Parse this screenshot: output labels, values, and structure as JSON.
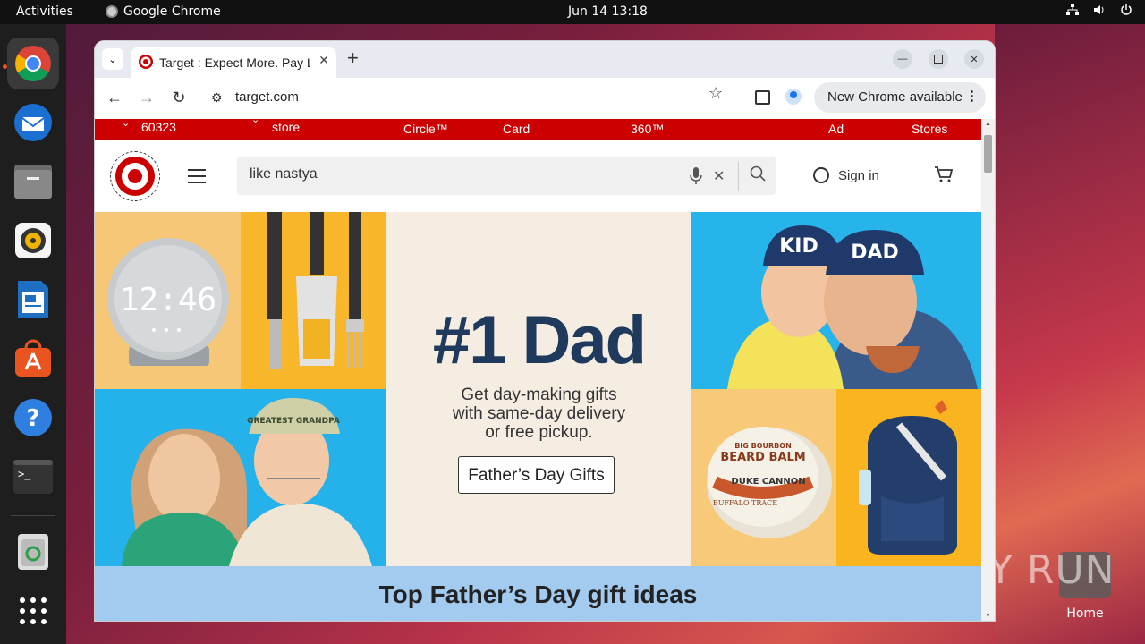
{
  "topbar": {
    "activities": "Activities",
    "app_name": "Google Chrome",
    "clock": "Jun 14  13:18"
  },
  "dock": {
    "items": [
      "chrome-icon",
      "thunderbird-icon",
      "files-icon",
      "rhythmbox-icon",
      "writer-icon",
      "software-icon",
      "help-icon",
      "terminal-icon",
      "trash-icon",
      "apps-grid-icon"
    ]
  },
  "desktop": {
    "home_label": "Home",
    "watermark": "ANY RUN"
  },
  "browser": {
    "tab_title": "Target : Expect More. Pay Less.",
    "new_tab": "+",
    "url": "target.com",
    "update_chip": "New Chrome available"
  },
  "page": {
    "redbar": {
      "zip": "60323",
      "store": "store",
      "circle": "Circle™",
      "card": "Card",
      "three60": "360™",
      "ad": "Ad",
      "stores": "Stores"
    },
    "search": {
      "value": "like nastya"
    },
    "sign_in": "Sign in",
    "hero": {
      "headline": "#1 Dad",
      "subline1": "Get day-making gifts",
      "subline2": "with same-day delivery",
      "subline3": "or free pickup.",
      "cta": "Father’s Day Gifts",
      "clock_display": "12:46",
      "cap_left": "KID",
      "cap_right": "DAD",
      "cap_grandpa": "GREATEST GRANDPA",
      "balm_top": "BIG BOURBON",
      "balm_title": "BEARD BALM",
      "balm_brand": "DUKE CANNON",
      "balm_sub": "BUFFALO TRACE"
    },
    "band_title": "Top Father’s Day gift ideas"
  },
  "colors": {
    "target_red": "#cc0000",
    "navy": "#1f3a5c",
    "band_blue": "#a3cbef"
  }
}
